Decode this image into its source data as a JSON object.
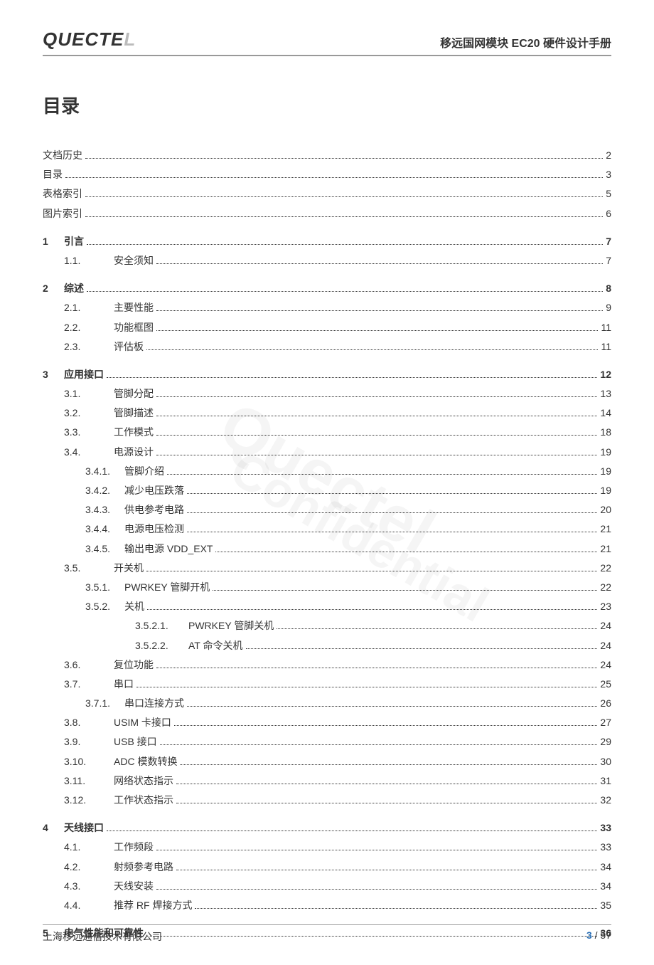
{
  "header": {
    "logo_main": "QUECTE",
    "logo_gray": "L",
    "doc_title": "移远国网模块 EC20 硬件设计手册"
  },
  "toc_title": "目录",
  "pre_entries": [
    {
      "label": "文档历史",
      "page": "2"
    },
    {
      "label": "目录",
      "page": "3"
    },
    {
      "label": "表格索引",
      "page": "5"
    },
    {
      "label": "图片索引",
      "page": "6"
    }
  ],
  "chapters": [
    {
      "num": "1",
      "label": "引言",
      "page": "7",
      "subs": [
        {
          "num": "1.1.",
          "label": "安全须知",
          "page": "7"
        }
      ]
    },
    {
      "num": "2",
      "label": "综述",
      "page": "8",
      "subs": [
        {
          "num": "2.1.",
          "label": "主要性能",
          "page": "9"
        },
        {
          "num": "2.2.",
          "label": "功能框图",
          "page": "11"
        },
        {
          "num": "2.3.",
          "label": "评估板",
          "page": "11"
        }
      ]
    },
    {
      "num": "3",
      "label": "应用接口",
      "page": "12",
      "subs": [
        {
          "num": "3.1.",
          "label": "管脚分配",
          "page": "13"
        },
        {
          "num": "3.2.",
          "label": "管脚描述",
          "page": "14"
        },
        {
          "num": "3.3.",
          "label": "工作模式",
          "page": "18"
        },
        {
          "num": "3.4.",
          "label": "电源设计",
          "page": "19",
          "subs": [
            {
              "num": "3.4.1.",
              "label": "管脚介绍",
              "page": "19"
            },
            {
              "num": "3.4.2.",
              "label": "减少电压跌落",
              "page": "19"
            },
            {
              "num": "3.4.3.",
              "label": "供电参考电路",
              "page": "20"
            },
            {
              "num": "3.4.4.",
              "label": "电源电压检测",
              "page": "21"
            },
            {
              "num": "3.4.5.",
              "label": "输出电源 VDD_EXT",
              "page": "21"
            }
          ]
        },
        {
          "num": "3.5.",
          "label": "开关机",
          "page": "22",
          "subs": [
            {
              "num": "3.5.1.",
              "label": "PWRKEY 管脚开机",
              "page": "22"
            },
            {
              "num": "3.5.2.",
              "label": "关机",
              "page": "23",
              "subs": [
                {
                  "num": "3.5.2.1.",
                  "label": "PWRKEY 管脚关机",
                  "page": "24"
                },
                {
                  "num": "3.5.2.2.",
                  "label": "AT 命令关机",
                  "page": "24"
                }
              ]
            }
          ]
        },
        {
          "num": "3.6.",
          "label": "复位功能",
          "page": "24"
        },
        {
          "num": "3.7.",
          "label": "串口",
          "page": "25",
          "subs": [
            {
              "num": "3.7.1.",
              "label": "串口连接方式",
              "page": "26"
            }
          ]
        },
        {
          "num": "3.8.",
          "label": "USIM 卡接口",
          "page": "27"
        },
        {
          "num": "3.9.",
          "label": "USB 接口",
          "page": "29"
        },
        {
          "num": "3.10.",
          "label": "ADC 模数转换",
          "page": "30"
        },
        {
          "num": "3.11.",
          "label": "网络状态指示",
          "page": "31"
        },
        {
          "num": "3.12.",
          "label": "工作状态指示",
          "page": "32"
        }
      ]
    },
    {
      "num": "4",
      "label": "天线接口",
      "page": "33",
      "subs": [
        {
          "num": "4.1.",
          "label": "工作频段",
          "page": "33"
        },
        {
          "num": "4.2.",
          "label": "射频参考电路",
          "page": "34"
        },
        {
          "num": "4.3.",
          "label": "天线安装",
          "page": "34"
        },
        {
          "num": "4.4.",
          "label": "推荐 RF 焊接方式",
          "page": "35"
        }
      ]
    },
    {
      "num": "5",
      "label": "电气性能和可靠性",
      "page": "36",
      "subs": []
    }
  ],
  "footer": {
    "company": "上海移远通信技术有限公司",
    "page_current": "3",
    "page_sep": " / ",
    "page_total": "57"
  },
  "watermark1": "Quectel",
  "watermark2": "Confidential"
}
